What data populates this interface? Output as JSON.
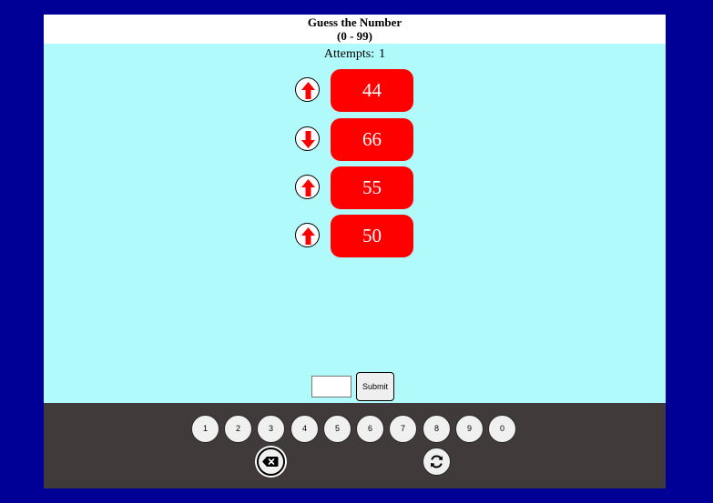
{
  "header": {
    "title": "Guess the Number",
    "range": "(0 - 99)"
  },
  "status": {
    "attempts_label": "Attempts:",
    "attempts_value": "1"
  },
  "guesses": [
    {
      "value": "44",
      "hint": "higher",
      "icon": "arrow-up-icon"
    },
    {
      "value": "66",
      "hint": "lower",
      "icon": "arrow-down-icon"
    },
    {
      "value": "55",
      "hint": "higher",
      "icon": "arrow-up-icon"
    },
    {
      "value": "50",
      "hint": "higher",
      "icon": "arrow-up-icon"
    }
  ],
  "input": {
    "value": "",
    "placeholder": ""
  },
  "submit_label": "Submit",
  "keypad": {
    "digits": [
      "1",
      "2",
      "3",
      "4",
      "5",
      "6",
      "7",
      "8",
      "9",
      "0"
    ],
    "backspace_icon": "backspace-icon",
    "reset_icon": "refresh-icon"
  },
  "colors": {
    "page_background": "#000096",
    "game_background": "#b0fafb",
    "guess_box": "#ff0000",
    "arrow": "#ff0000",
    "keypad_background": "#403a3a"
  }
}
